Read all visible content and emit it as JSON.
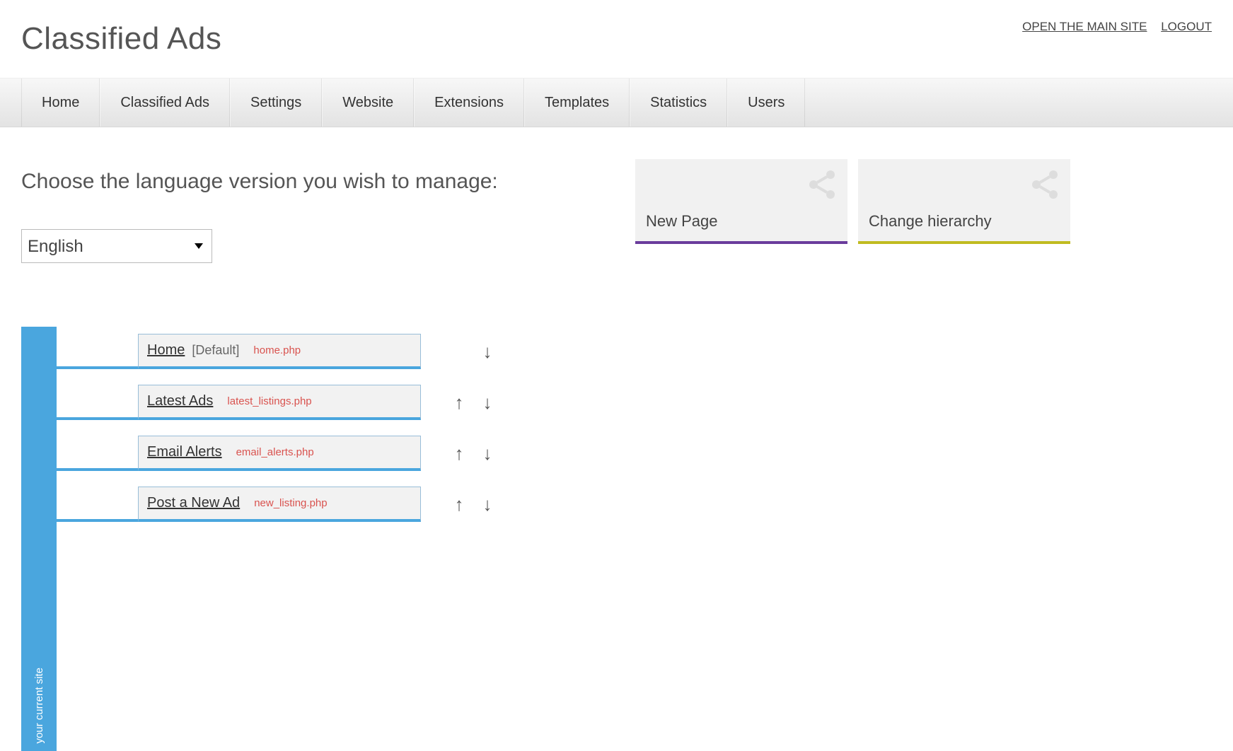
{
  "header": {
    "title": "Classified Ads",
    "open_site_link": "OPEN THE MAIN SITE",
    "logout_link": "LOGOUT"
  },
  "nav": [
    "Home",
    "Classified Ads",
    "Settings",
    "Website",
    "Extensions",
    "Templates",
    "Statistics",
    "Users"
  ],
  "lang": {
    "prompt": "Choose the language version you wish to manage:",
    "selected": "English"
  },
  "tiles": {
    "new_page": "New Page",
    "change_hierarchy": "Change hierarchy"
  },
  "tree": {
    "root_label": "your current site",
    "default_tag": "[Default]",
    "pages": [
      {
        "name": "Home",
        "file": "home.php",
        "is_default": true,
        "up": false,
        "down": true
      },
      {
        "name": "Latest Ads",
        "file": "latest_listings.php",
        "is_default": false,
        "up": true,
        "down": true
      },
      {
        "name": "Email Alerts",
        "file": "email_alerts.php",
        "is_default": false,
        "up": true,
        "down": true
      },
      {
        "name": "Post a New Ad",
        "file": "new_listing.php",
        "is_default": false,
        "up": true,
        "down": true
      }
    ]
  }
}
